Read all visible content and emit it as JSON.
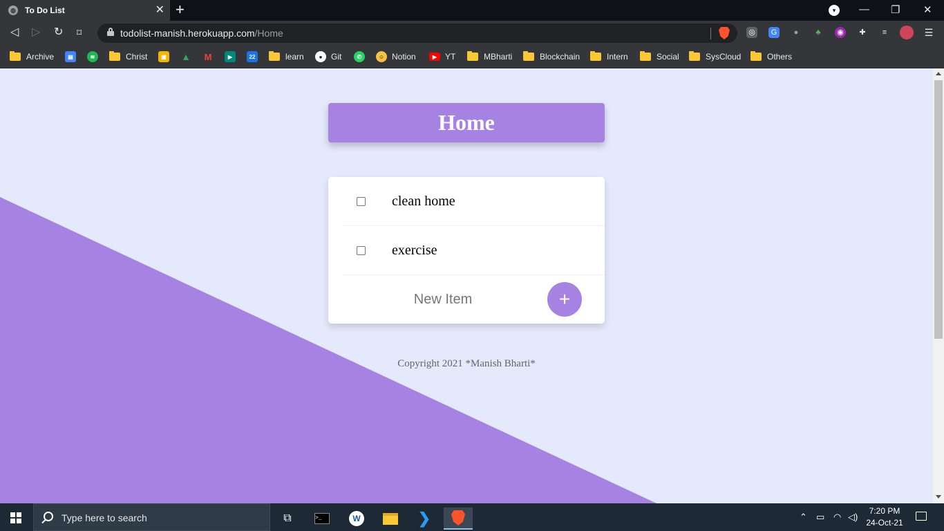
{
  "browser": {
    "tab_title": "To Do List",
    "tab_close": "✕",
    "new_tab": "+",
    "url_host": "todolist-manish.herokuapp.com",
    "url_path": "/Home",
    "window_controls": {
      "minimize": "—",
      "restore": "❐",
      "close": "✕"
    },
    "bookmarks": [
      {
        "label": "Archive",
        "icon": "folder-icon"
      },
      {
        "label": "",
        "icon": "google-forms-icon",
        "color": "#4285f4"
      },
      {
        "label": "",
        "icon": "spotify-icon",
        "color": "#1db954"
      },
      {
        "label": "Christ",
        "icon": "folder-icon"
      },
      {
        "label": "",
        "icon": "google-classroom-icon",
        "color": "#f4b400"
      },
      {
        "label": "",
        "icon": "google-drive-icon",
        "color": "#34a853"
      },
      {
        "label": "",
        "icon": "gmail-icon",
        "color": "#ea4335"
      },
      {
        "label": "",
        "icon": "google-meet-icon",
        "color": "#00897b"
      },
      {
        "label": "",
        "icon": "google-calendar-icon",
        "color": "#1a73e8"
      },
      {
        "label": "learn",
        "icon": "folder-icon"
      },
      {
        "label": "Git",
        "icon": "github-icon"
      },
      {
        "label": "",
        "icon": "whatsapp-icon",
        "color": "#25d366"
      },
      {
        "label": "Notion",
        "icon": "notion-icon"
      },
      {
        "label": "YT",
        "icon": "youtube-icon",
        "color": "#ff0000"
      },
      {
        "label": "MBharti",
        "icon": "folder-icon"
      },
      {
        "label": "Blockchain",
        "icon": "folder-icon"
      },
      {
        "label": "Intern",
        "icon": "folder-icon"
      },
      {
        "label": "Social",
        "icon": "folder-icon"
      },
      {
        "label": "SysCloud",
        "icon": "folder-icon"
      },
      {
        "label": "Others",
        "icon": "folder-icon"
      }
    ]
  },
  "page": {
    "heading": "Home",
    "items": [
      {
        "text": "clean home",
        "checked": false
      },
      {
        "text": "exercise",
        "checked": false
      }
    ],
    "new_item_placeholder": "New Item",
    "add_button_label": "+",
    "footer": "Copyright 2021 *Manish Bharti*",
    "colors": {
      "accent": "#a683e3",
      "background": "#e4e9fb"
    }
  },
  "taskbar": {
    "search_placeholder": "Type here to search",
    "time": "7:20 PM",
    "date": "24-Oct-21"
  }
}
